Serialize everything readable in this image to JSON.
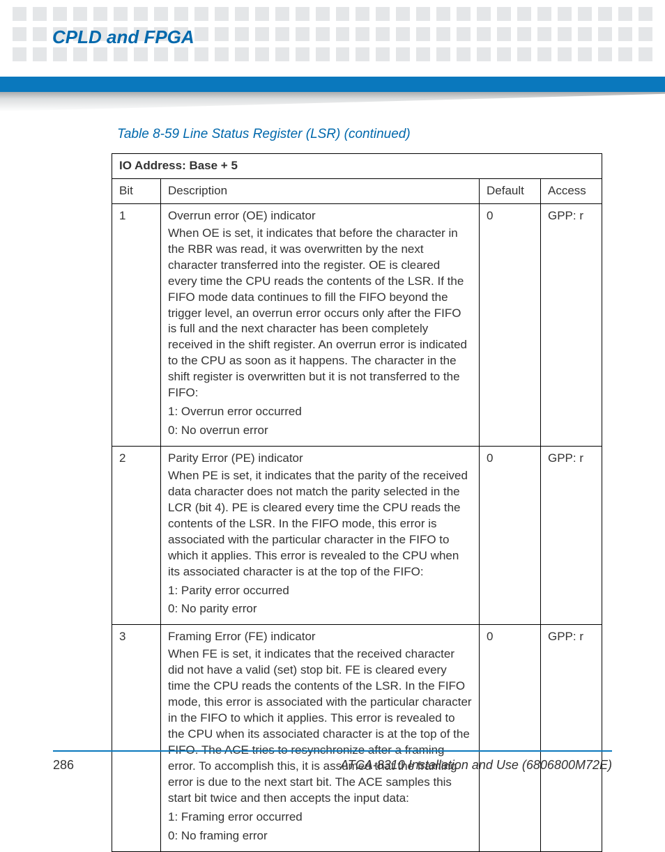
{
  "chapter_title": "CPLD and FPGA",
  "table_caption": "Table 8-59 Line Status Register (LSR) (continued)",
  "io_address": "IO Address: Base + 5",
  "columns": {
    "bit": "Bit",
    "desc": "Description",
    "def": "Default",
    "acc": "Access"
  },
  "rows": [
    {
      "bit": "1",
      "title": "Overrun error (OE) indicator",
      "body": "When OE is set, it indicates that before the character in the RBR was read, it was overwritten by the next character transferred into the register. OE is cleared every time the CPU reads the contents of the LSR. If the FIFO mode data continues to fill the FIFO beyond the trigger level, an overrun error occurs only after the FIFO is full and the next character has been completely received in the shift register. An overrun error is indicated to the CPU as soon as it happens. The character in the shift register is overwritten but it is not transferred to the FIFO:",
      "v1": "1: Overrun error occurred",
      "v0": "0: No overrun error",
      "def": "0",
      "acc": "GPP: r"
    },
    {
      "bit": "2",
      "title": "Parity Error (PE) indicator",
      "body": "When PE is set, it indicates that the parity of the received data character does not match the parity selected in the LCR (bit 4). PE is cleared every time the CPU reads the contents of the LSR. In the FIFO mode, this error is associated with the particular character in the FIFO to which it applies. This error is revealed to the CPU when its associated character is at the top of the FIFO:",
      "v1": "1: Parity error occurred",
      "v0": "0: No parity error",
      "def": "0",
      "acc": "GPP: r"
    },
    {
      "bit": "3",
      "title": "Framing Error (FE) indicator",
      "body": "When FE is set, it indicates that the received character did not have a valid (set) stop bit. FE is cleared every time the CPU reads the contents of the LSR. In the FIFO mode, this error is associated with the particular character in the FIFO to which it applies. This error is revealed to the CPU when its associated character is at the top of the FIFO. The ACE tries to resynchronize after a framing error. To accomplish this, it is assumed that the framing error is due to the next start bit. The ACE samples this start bit twice and then accepts the input data:",
      "v1": "1: Framing error occurred",
      "v0": "0: No framing error",
      "def": "0",
      "acc": "GPP: r"
    }
  ],
  "page_number": "286",
  "doc_id": "ATCA-8310 Installation and Use (6806800M72E)"
}
